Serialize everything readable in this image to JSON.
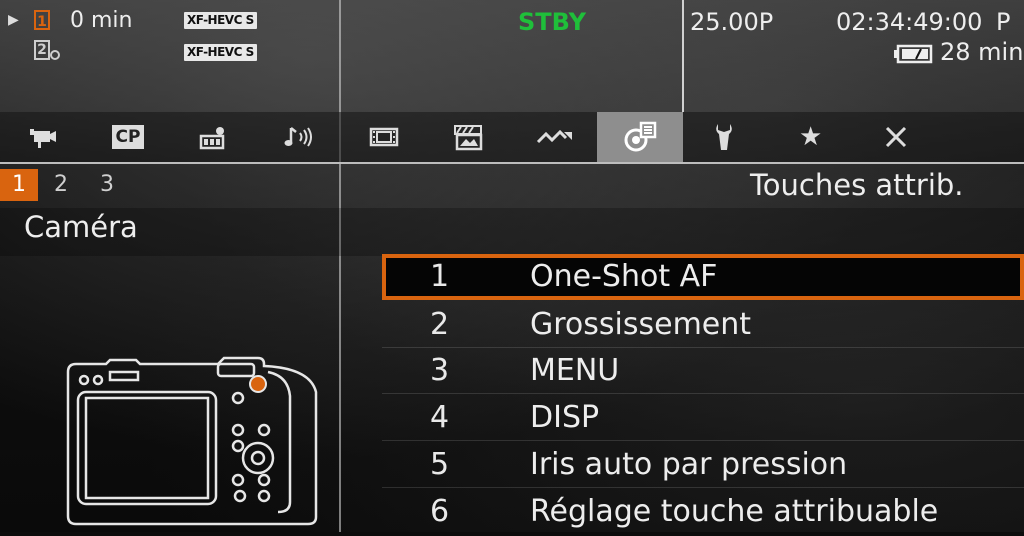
{
  "status": {
    "rec_time": "0 min",
    "codec1": "XF-HEVC S",
    "codec2": "XF-HEVC S",
    "mode": "STBY",
    "frame_rate": "25.00P",
    "timecode": "02:34:49:00",
    "tc_flag": "P",
    "battery_time": "28 min",
    "colors": {
      "mode": "#1fbf3a",
      "accent": "#d9640f"
    }
  },
  "tabs": [
    {
      "icon": "video-camera-icon"
    },
    {
      "icon": "custom-picture-icon",
      "label": "CP"
    },
    {
      "icon": "recording-setup-icon"
    },
    {
      "icon": "audio-icon"
    },
    {
      "icon": "film-strip-icon"
    },
    {
      "icon": "playback-icon"
    },
    {
      "icon": "system-icon"
    },
    {
      "icon": "assign-buttons-icon",
      "active": true
    },
    {
      "icon": "wrench-icon"
    },
    {
      "icon": "star-icon"
    },
    {
      "icon": "close-icon"
    }
  ],
  "pages": [
    "1",
    "2",
    "3"
  ],
  "section_title": "Touches attrib.",
  "category": "Caméra",
  "menu": [
    {
      "num": "1",
      "label": "One-Shot AF",
      "selected": true
    },
    {
      "num": "2",
      "label": "Grossissement"
    },
    {
      "num": "3",
      "label": "MENU"
    },
    {
      "num": "4",
      "label": "DISP"
    },
    {
      "num": "5",
      "label": "Iris auto par pression"
    },
    {
      "num": "6",
      "label": "Réglage touche attribuable"
    }
  ]
}
